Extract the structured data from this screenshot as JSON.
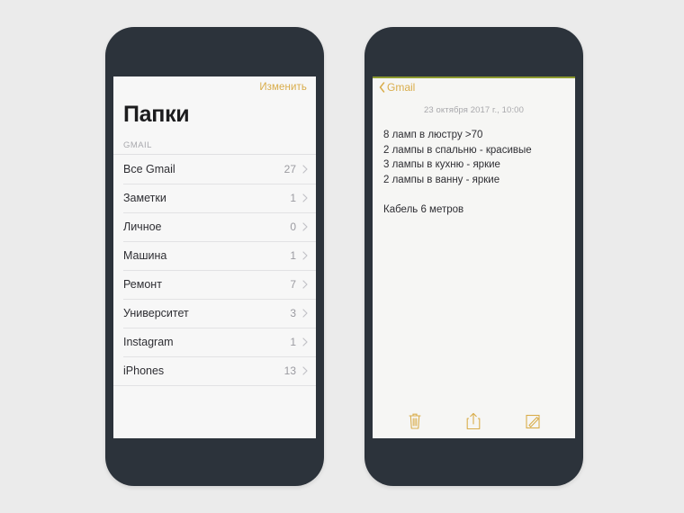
{
  "background_color": "#ebebeb",
  "frame_color": "#2c333b",
  "accent_color": "#d9ad4b",
  "top_accent_color": "#8d9a2e",
  "left_phone": {
    "screen_name": "folders-screen",
    "nav": {
      "edit_label": "Изменить"
    },
    "title": "Папки",
    "section_header": "GMAIL",
    "folders": [
      {
        "label": "Все Gmail",
        "count": "27"
      },
      {
        "label": "Заметки",
        "count": "1"
      },
      {
        "label": "Личное",
        "count": "0"
      },
      {
        "label": "Машина",
        "count": "1"
      },
      {
        "label": "Ремонт",
        "count": "7"
      },
      {
        "label": "Университет",
        "count": "3"
      },
      {
        "label": "Instagram",
        "count": "1"
      },
      {
        "label": "iPhones",
        "count": "13"
      }
    ]
  },
  "right_phone": {
    "screen_name": "note-detail-screen",
    "nav": {
      "back_label": "Gmail"
    },
    "date": "23 октября 2017 г., 10:00",
    "note_text": "8 ламп в люстру >70\n2 лампы в спальню - красивые\n3 лампы в кухню - яркие\n2 лампы в ванну - яркие\n\nКабель 6 метров",
    "toolbar": [
      {
        "name": "trash-icon",
        "label": "Удалить"
      },
      {
        "name": "share-icon",
        "label": "Поделиться"
      },
      {
        "name": "compose-icon",
        "label": "Создать"
      }
    ]
  }
}
